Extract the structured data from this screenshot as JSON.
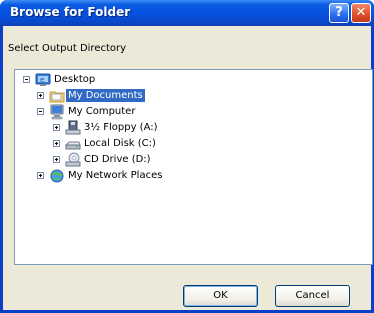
{
  "window": {
    "title": "Browse for Folder",
    "help_label": "?",
    "close_label": "✕"
  },
  "prompt": "Select Output Directory",
  "tree": {
    "items": [
      {
        "label": "Desktop",
        "icon": "desktop-icon",
        "expanded": true
      },
      {
        "label": "My Documents",
        "icon": "folder-icon",
        "selected": true
      },
      {
        "label": "My Computer",
        "icon": "computer-icon",
        "expanded": true
      },
      {
        "label": "3½ Floppy (A:)",
        "icon": "floppy-drive-icon"
      },
      {
        "label": "Local Disk (C:)",
        "icon": "hard-disk-icon"
      },
      {
        "label": "CD Drive (D:)",
        "icon": "cd-drive-icon"
      },
      {
        "label": "My Network Places",
        "icon": "network-places-icon"
      }
    ]
  },
  "buttons": {
    "ok": "OK",
    "cancel": "Cancel"
  },
  "colors": {
    "title_bar": "#0a4fd6",
    "selection": "#316ac5",
    "dialog_background": "#ece9d8"
  }
}
